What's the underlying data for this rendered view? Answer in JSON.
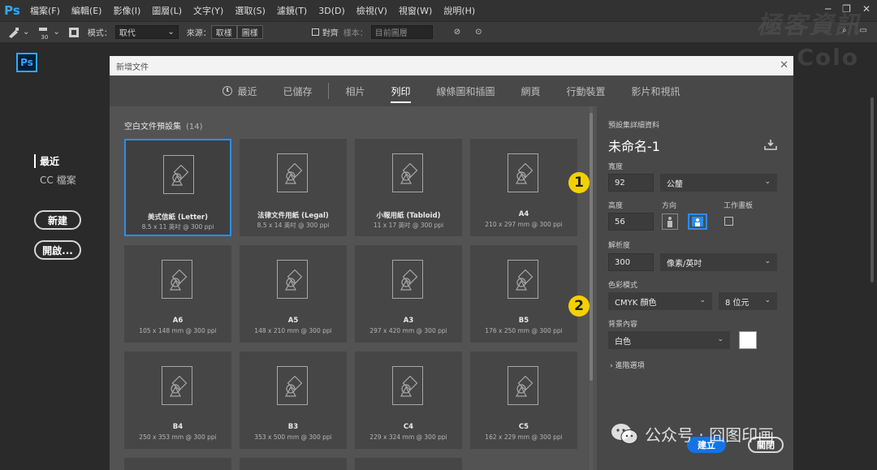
{
  "app": {
    "logo": "Ps"
  },
  "menu": {
    "items": [
      "檔案(F)",
      "編輯(E)",
      "影像(I)",
      "圖層(L)",
      "文字(Y)",
      "選取(S)",
      "濾鏡(T)",
      "3D(D)",
      "檢視(V)",
      "視窗(W)",
      "說明(H)"
    ]
  },
  "window_controls": {
    "minimize": "─",
    "restore": "❐",
    "close": "✕"
  },
  "options_bar": {
    "brush_size": "30",
    "mode_label": "模式：",
    "mode_value": "取代",
    "source_label": "來源：",
    "source_btn1": "取樣",
    "source_btn2": "圖樣",
    "align_label": "對齊",
    "sample_label": "樣本：",
    "sample_value": "目前圖層"
  },
  "home": {
    "logo": "Ps",
    "nav_recent": "最近",
    "nav_cc": "CC 檔案",
    "new_btn": "新建",
    "open_btn": "開啟..."
  },
  "watermark": {
    "top": "極客資訊",
    "bottom": "Colo"
  },
  "dialog": {
    "title": "新增文件",
    "close": "✕",
    "tabs": [
      "最近",
      "已儲存",
      "相片",
      "列印",
      "線條圖和插圖",
      "網頁",
      "行動裝置",
      "影片和視訊"
    ],
    "active_tab": "列印",
    "presets_title": "空白文件預設集",
    "presets_count": "(14)",
    "presets": [
      {
        "name": "美式信紙 (Letter)",
        "size": "8.5 x 11 英吋 @ 300 ppi"
      },
      {
        "name": "法律文件用紙 (Legal)",
        "size": "8.5 x 14 英吋 @ 300 ppi"
      },
      {
        "name": "小報用紙 (Tabloid)",
        "size": "11 x 17 英吋 @ 300 ppi"
      },
      {
        "name": "A4",
        "size": "210 x 297 mm @ 300 ppi"
      },
      {
        "name": "A6",
        "size": "105 x 148 mm @ 300 ppi"
      },
      {
        "name": "A5",
        "size": "148 x 210 mm @ 300 ppi"
      },
      {
        "name": "A3",
        "size": "297 x 420 mm @ 300 ppi"
      },
      {
        "name": "B5",
        "size": "176 x 250 mm @ 300 ppi"
      },
      {
        "name": "B4",
        "size": "250 x 353 mm @ 300 ppi"
      },
      {
        "name": "B3",
        "size": "353 x 500 mm @ 300 ppi"
      },
      {
        "name": "C4",
        "size": "229 x 324 mm @ 300 ppi"
      },
      {
        "name": "C5",
        "size": "162 x 229 mm @ 300 ppi"
      }
    ],
    "details": {
      "title": "預設集詳細資料",
      "doc_name": "未命名-1",
      "width_label": "寬度",
      "width_value": "92",
      "width_unit": "公釐",
      "height_label": "高度",
      "height_value": "56",
      "orientation_label": "方向",
      "artboard_label": "工作畫板",
      "resolution_label": "解析度",
      "resolution_value": "300",
      "resolution_unit": "像素/英吋",
      "color_mode_label": "色彩模式",
      "color_mode_value": "CMYK 顏色",
      "bit_depth": "8 位元",
      "background_label": "背景內容",
      "background_value": "白色",
      "background_color": "#ffffff",
      "advanced": "進階選項"
    },
    "create_btn": "建立",
    "close_btn": "關閉"
  },
  "badges": [
    "1",
    "2"
  ],
  "wechat_watermark": "公众号 · 囧图印画",
  "colors": {
    "accent": "#2d8ceb",
    "ps_blue": "#31a8ff",
    "badge": "#f5d000",
    "create": "#1473e6"
  }
}
